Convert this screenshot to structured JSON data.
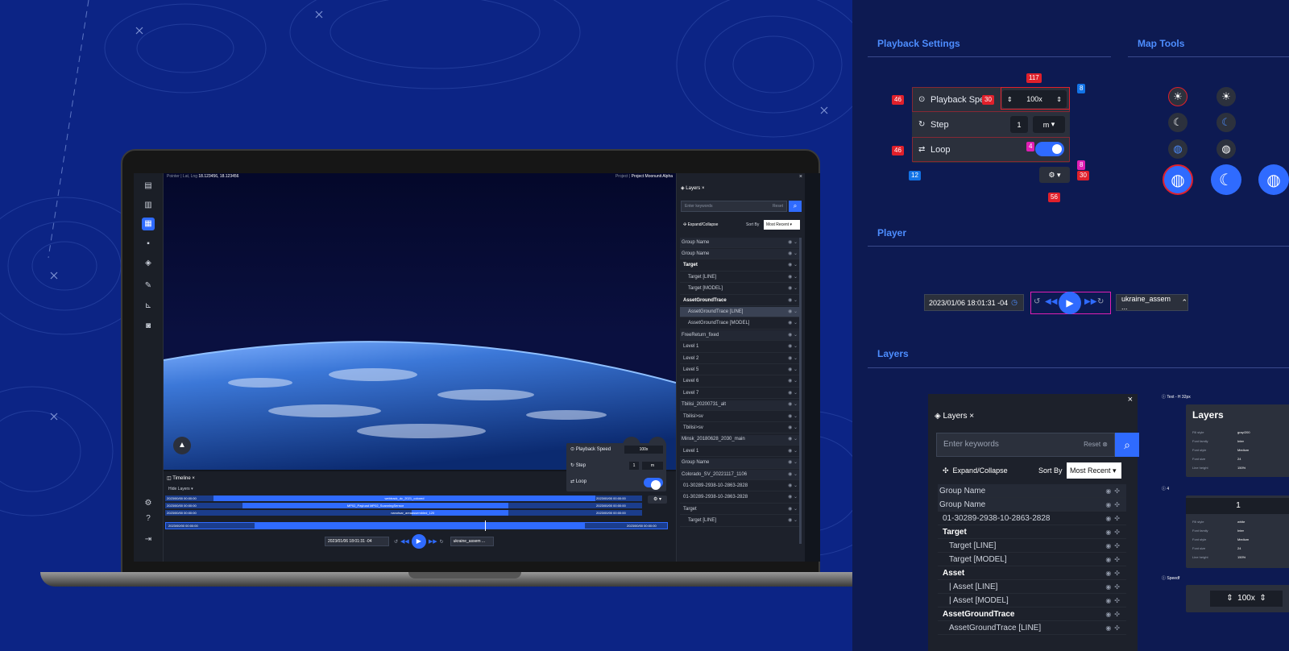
{
  "laptop": {
    "pointer_label": "Pointer",
    "latlng_label": "Lat, Lng",
    "latlng_value": "18.123456, 18.123456",
    "project_label": "Project",
    "project_value": "Project Moonunit Alpha",
    "layers_tab": "Layers",
    "search_placeholder": "Enter keywords",
    "reset_label": "Reset",
    "expand_collapse": "Expand/Collapse",
    "sort_by": "Sort By",
    "sort_value": "Most Recent",
    "layer_rows": [
      {
        "label": "Group Name",
        "kind": "grp"
      },
      {
        "label": "Group Name",
        "kind": "grp"
      },
      {
        "label": "Target",
        "kind": "bold"
      },
      {
        "label": "Target [LINE]",
        "kind": "child"
      },
      {
        "label": "Target [MODEL]",
        "kind": "child"
      },
      {
        "label": "AssetGroundTrace",
        "kind": "bold"
      },
      {
        "label": "AssetGroundTrace [LINE]",
        "kind": "sel"
      },
      {
        "label": "AssetGroundTrace [MODEL]",
        "kind": "child"
      },
      {
        "label": "FreeReturn_fixed",
        "kind": "grp"
      },
      {
        "label": "Level 1",
        "kind": "item"
      },
      {
        "label": "Level 2",
        "kind": "item"
      },
      {
        "label": "Level 5",
        "kind": "item"
      },
      {
        "label": "Level 6",
        "kind": "item"
      },
      {
        "label": "Level 7",
        "kind": "item"
      },
      {
        "label": "Tbilisi_20200731_alt",
        "kind": "grp"
      },
      {
        "label": "Tbilisi>sv",
        "kind": "item"
      },
      {
        "label": "Tbilisi>sv",
        "kind": "item"
      },
      {
        "label": "Minsk_20180628_2030_main",
        "kind": "grp"
      },
      {
        "label": "Level 1",
        "kind": "item"
      },
      {
        "label": "Group Name",
        "kind": "grp"
      },
      {
        "label": "Colorado_SV_20221117_1106",
        "kind": "grp"
      },
      {
        "label": "01-30289-2938-10-2863-2828",
        "kind": "item"
      },
      {
        "label": "01-30289-2938-10-2863-2828",
        "kind": "item"
      },
      {
        "label": "Target",
        "kind": "item"
      },
      {
        "label": "Target [LINE]",
        "kind": "child"
      }
    ],
    "timeline_tab": "Timeline",
    "hide_layers": "Hide Layers",
    "timeline_bars": [
      {
        "start": "2023/00/00 00:00:00",
        "label": "webtrack_dc_2021_colored",
        "end": "2023/00/00 00:00:00"
      },
      {
        "start": "2023/00/00 00:00:00",
        "label": "MP02_Payload MP02_ScanningSensor",
        "end": "2023/00/00 00:00:00"
      },
      {
        "start": "2023/00/00 00:00:00",
        "label": "nanotsar_area",
        "label2": "assembled_120",
        "end": "2023/00/00 00:00:00"
      }
    ],
    "master_start": "2023/00/00 00:00:00",
    "master_end": "2023/00/00 00:00:00",
    "date_value": "2023/01/06 18:01:31 -04",
    "layer_select": "ukraine_assem ...",
    "popover": {
      "speed_label": "Playback Speed",
      "speed_value": "100x",
      "step_label": "Step",
      "step_value": "1",
      "step_unit": "m",
      "loop_label": "Loop"
    }
  },
  "right": {
    "playback_title": "Playback Settings",
    "maptools_title": "Map Tools",
    "player_title": "Player",
    "layers_title": "Layers",
    "speed_label": "Playback Speed",
    "speed_value": "100x",
    "step_label": "Step",
    "step_value": "1",
    "step_unit": "m",
    "loop_label": "Loop",
    "dims": {
      "a": "117",
      "b": "46",
      "c": "30",
      "d": "8",
      "e": "46",
      "f": "4",
      "g": "12",
      "h": "8",
      "i": "30",
      "j": "56"
    },
    "player_date": "2023/01/06 18:01:31 -04",
    "player_layer": "ukraine_assem ...",
    "ly_tab": "Layers",
    "ly_placeholder": "Enter keywords",
    "ly_reset": "Reset",
    "ly_expand": "Expand/Collapse",
    "ly_sortby": "Sort By",
    "ly_sortval": "Most Recent",
    "ly_rows": [
      {
        "label": "Group Name",
        "kind": "grp"
      },
      {
        "label": "Group Name",
        "kind": "grp"
      },
      {
        "label": "01-30289-2938-10-2863-2828",
        "kind": "item"
      },
      {
        "label": "Target",
        "kind": "bold"
      },
      {
        "label": "Target [LINE]",
        "kind": "child"
      },
      {
        "label": "Target [MODEL]",
        "kind": "child"
      },
      {
        "label": "Asset",
        "kind": "bold"
      },
      {
        "label": "| Asset [LINE]",
        "kind": "child"
      },
      {
        "label": "| Asset [MODEL]",
        "kind": "child"
      },
      {
        "label": "AssetGroundTrace",
        "kind": "bold"
      },
      {
        "label": "AssetGroundTrace [LINE]",
        "kind": "child"
      }
    ],
    "spec1_caption": "Text - H 32px",
    "spec1_title": "Layers",
    "spec1_rows": [
      "Fill style",
      "gray/200",
      "Font family",
      "Inter",
      "Font style",
      "Medium",
      "Font size",
      "24",
      "Line height",
      "150%"
    ],
    "spec2_caption": "4",
    "spec2_title": "1",
    "spec2_rows": [
      "Fill style",
      "white",
      "Font family",
      "Inter",
      "Font style",
      "Medium",
      "Font size",
      "24",
      "Line height",
      "150%"
    ],
    "spec3_caption": "Speedf",
    "spec3_value": "100x"
  },
  "colors": {
    "background": "#0c2485",
    "accent": "#2f6bff",
    "panel": "#1d212b",
    "dimension": "#e0202b",
    "spacing": "#1273e6",
    "padding": "#e01eb4"
  }
}
